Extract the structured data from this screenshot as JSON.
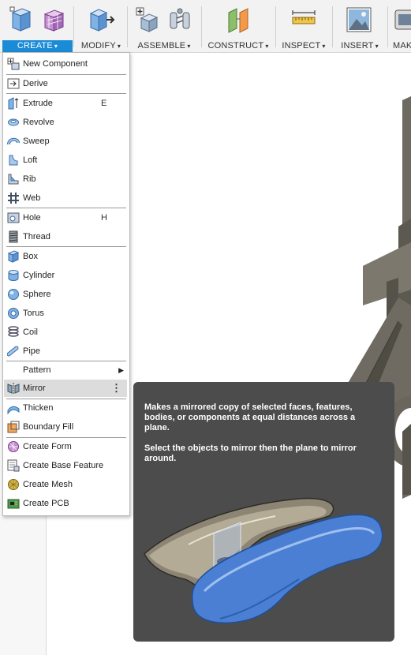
{
  "toolbar": {
    "groups": [
      {
        "label": "CREATE",
        "active": true
      },
      {
        "label": "MODIFY"
      },
      {
        "label": "ASSEMBLE"
      },
      {
        "label": "CONSTRUCT"
      },
      {
        "label": "INSPECT"
      },
      {
        "label": "INSERT"
      },
      {
        "label": "MAK"
      }
    ],
    "caret": "▾"
  },
  "menu": {
    "items": [
      {
        "label": "New Component",
        "icon": "new-component-icon"
      },
      {
        "label": "Derive",
        "icon": "derive-icon"
      },
      {
        "label": "Extrude",
        "shortcut": "E",
        "icon": "extrude-icon"
      },
      {
        "label": "Revolve",
        "icon": "revolve-icon"
      },
      {
        "label": "Sweep",
        "icon": "sweep-icon"
      },
      {
        "label": "Loft",
        "icon": "loft-icon"
      },
      {
        "label": "Rib",
        "icon": "rib-icon"
      },
      {
        "label": "Web",
        "icon": "web-icon"
      },
      {
        "label": "Hole",
        "shortcut": "H",
        "icon": "hole-icon"
      },
      {
        "label": "Thread",
        "icon": "thread-icon"
      },
      {
        "label": "Box",
        "icon": "box-icon"
      },
      {
        "label": "Cylinder",
        "icon": "cylinder-icon"
      },
      {
        "label": "Sphere",
        "icon": "sphere-icon"
      },
      {
        "label": "Torus",
        "icon": "torus-icon"
      },
      {
        "label": "Coil",
        "icon": "coil-icon"
      },
      {
        "label": "Pipe",
        "icon": "pipe-icon"
      },
      {
        "label": "Pattern",
        "arrow": "▶"
      },
      {
        "label": "Mirror",
        "icon": "mirror-icon",
        "more": "⋮",
        "highlighted": true
      },
      {
        "label": "Thicken",
        "icon": "thicken-icon"
      },
      {
        "label": "Boundary Fill",
        "icon": "boundary-fill-icon"
      },
      {
        "label": "Create Form",
        "icon": "create-form-icon"
      },
      {
        "label": "Create Base Feature",
        "icon": "create-base-feature-icon"
      },
      {
        "label": "Create Mesh",
        "icon": "create-mesh-icon"
      },
      {
        "label": "Create PCB",
        "icon": "create-pcb-icon"
      }
    ]
  },
  "tooltip": {
    "line1": "Makes a mirrored copy of selected faces, features,",
    "line2": "bodies, or components at equal distances across a",
    "line3": "plane.",
    "line4": "Select the objects to mirror then the plane to mirror",
    "line5": "around."
  },
  "colors": {
    "accent": "#1a8bd6",
    "menu_highlight": "#dcdcdc",
    "tooltip_bg": "#4c4c4c",
    "model_body": "#6d6a61",
    "mirror_blue": "#4a7fd4"
  }
}
